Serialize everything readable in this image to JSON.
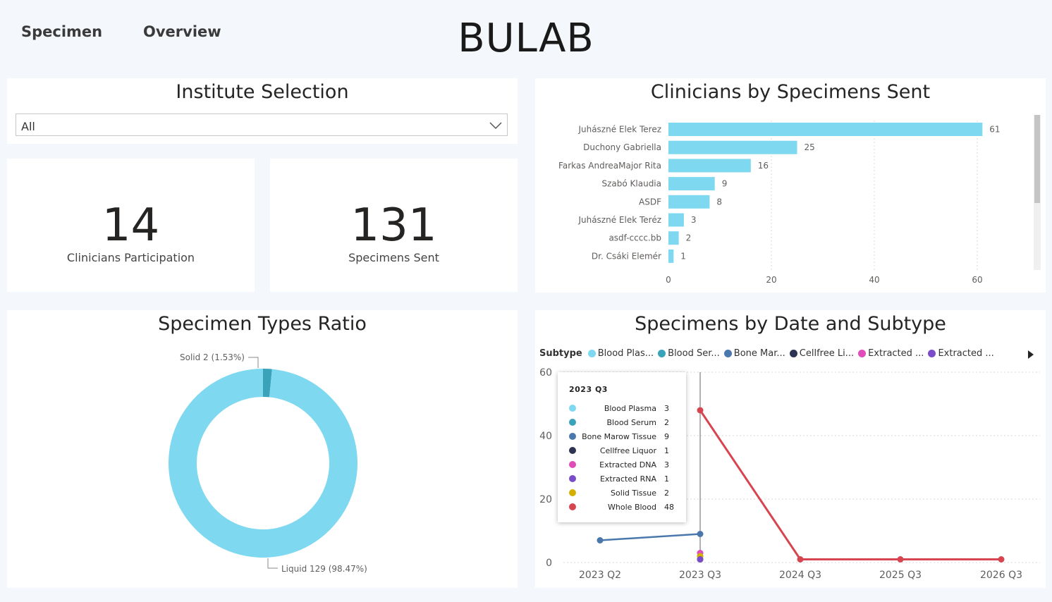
{
  "nav": {
    "specimen": "Specimen",
    "overview": "Overview"
  },
  "header": {
    "title": "BULAB"
  },
  "institute": {
    "title": "Institute Selection",
    "selected": "All"
  },
  "kpis": {
    "clinicians": {
      "value": "14",
      "label": "Clinicians Participation"
    },
    "specimens": {
      "value": "131",
      "label": "Specimens Sent"
    }
  },
  "titles": {
    "clinicians_chart": "Clinicians by Specimens Sent",
    "types_chart": "Specimen Types Ratio",
    "date_chart": "Specimens by Date and Subtype"
  },
  "colors": {
    "bar": "#7dd8f0",
    "donut_liquid": "#7dd8f0",
    "donut_solid": "#3aa3ba",
    "whole_blood": "#d64550",
    "bone_marrow": "#4a78ad"
  },
  "chart_data": [
    {
      "type": "bar",
      "orientation": "horizontal",
      "title": "Clinicians by Specimens Sent",
      "categories": [
        "Juhászné Elek Terez",
        "Duchony Gabriella",
        "Farkas AndreaMajor Rita",
        "Szabó Klaudia",
        "ASDF",
        "Juhászné Elek Teréz",
        "asdf-cccc.bb",
        "Dr. Csáki Elemér"
      ],
      "values": [
        61,
        25,
        16,
        9,
        8,
        3,
        2,
        1
      ],
      "xlim": [
        0,
        70
      ],
      "xticks": [
        "0",
        "20",
        "40",
        "60"
      ],
      "grid": true
    },
    {
      "type": "pie",
      "donut": true,
      "title": "Specimen Types Ratio",
      "slices": [
        {
          "label": "Solid",
          "value": 2,
          "label_text": "Solid 2 (1.53%)",
          "color": "#3aa3ba"
        },
        {
          "label": "Liquid",
          "value": 129,
          "label_text": "Liquid 129 (98.47%)",
          "color": "#7dd8f0"
        }
      ]
    },
    {
      "type": "line",
      "title": "Specimens by Date and Subtype",
      "legend_title": "Subtype",
      "legend_placement": "top",
      "legend_visible": [
        {
          "label": "Blood Plas...",
          "color": "#7dd8f0"
        },
        {
          "label": "Blood Ser...",
          "color": "#3aa3ba"
        },
        {
          "label": "Bone Mar...",
          "color": "#4a78ad"
        },
        {
          "label": "Cellfree Li...",
          "color": "#2d3452"
        },
        {
          "label": "Extracted ...",
          "color": "#e04db8"
        },
        {
          "label": "Extracted ...",
          "color": "#7a4cc9"
        }
      ],
      "categories": [
        "2023 Q2",
        "2023 Q3",
        "2024 Q3",
        "2025 Q3",
        "2026 Q3"
      ],
      "ylim": [
        0,
        60
      ],
      "yticks": [
        "0",
        "20",
        "40",
        "60"
      ],
      "grid": true,
      "series": [
        {
          "name": "Whole Blood",
          "color": "#d64550",
          "values": [
            null,
            48,
            1,
            1,
            1
          ]
        },
        {
          "name": "Bone Marow Tissue",
          "color": "#4a78ad",
          "values": [
            7,
            9,
            null,
            null,
            null
          ]
        },
        {
          "name": "Blood Plasma",
          "color": "#7dd8f0",
          "values": [
            null,
            3,
            null,
            null,
            null
          ]
        },
        {
          "name": "Extracted DNA",
          "color": "#e04db8",
          "values": [
            null,
            3,
            null,
            null,
            null
          ]
        },
        {
          "name": "Blood Serum",
          "color": "#3aa3ba",
          "values": [
            null,
            2,
            null,
            null,
            null
          ]
        },
        {
          "name": "Solid Tissue",
          "color": "#d6b000",
          "values": [
            null,
            2,
            null,
            null,
            null
          ]
        },
        {
          "name": "Cellfree Liquor",
          "color": "#2d3452",
          "values": [
            null,
            1,
            null,
            null,
            null
          ]
        },
        {
          "name": "Extracted RNA",
          "color": "#7a4cc9",
          "values": [
            null,
            1,
            null,
            null,
            null
          ]
        }
      ],
      "tooltip": {
        "title": "2023 Q3",
        "rows": [
          {
            "name": "Blood Plasma",
            "value": "3",
            "color": "#7dd8f0"
          },
          {
            "name": "Blood Serum",
            "value": "2",
            "color": "#3aa3ba"
          },
          {
            "name": "Bone Marow Tissue",
            "value": "9",
            "color": "#4a78ad"
          },
          {
            "name": "Cellfree Liquor",
            "value": "1",
            "color": "#2d3452"
          },
          {
            "name": "Extracted DNA",
            "value": "3",
            "color": "#e04db8"
          },
          {
            "name": "Extracted RNA",
            "value": "1",
            "color": "#7a4cc9"
          },
          {
            "name": "Solid Tissue",
            "value": "2",
            "color": "#d6b000"
          },
          {
            "name": "Whole Blood",
            "value": "48",
            "color": "#d64550"
          }
        ]
      }
    }
  ]
}
